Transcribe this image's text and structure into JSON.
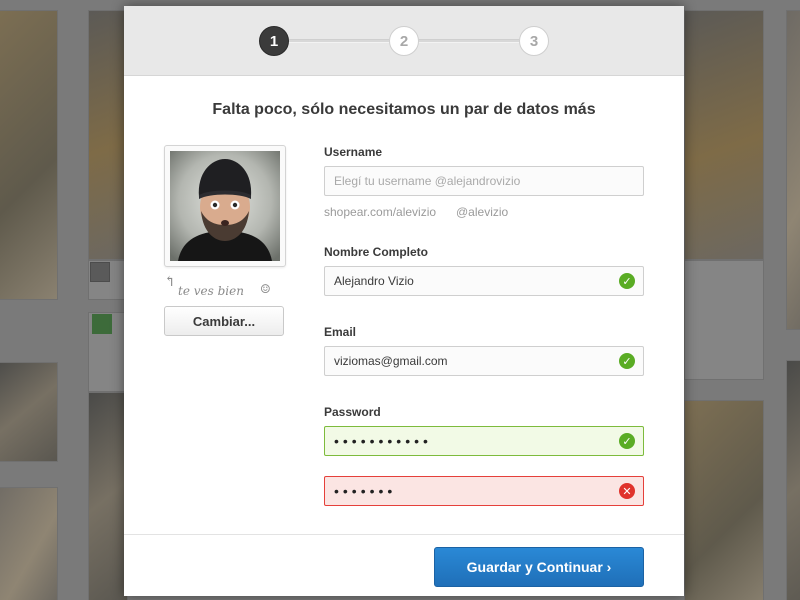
{
  "steps": [
    "1",
    "2",
    "3"
  ],
  "active_step": 1,
  "title": "Falta poco, sólo necesitamos un par de datos más",
  "profile": {
    "photo_icon": "user-photo",
    "caption": "te ves bien",
    "caption_icon": "curved-arrow-icon",
    "smile_icon": "smile-icon",
    "change_label": "Cambiar..."
  },
  "form": {
    "username": {
      "label": "Username",
      "placeholder": "Elegí tu username @alejandrovizio",
      "url_hint": "shopear.com/alevizio",
      "handle_hint": "@alevizio"
    },
    "fullname": {
      "label": "Nombre Completo",
      "value": "Alejandro Vizio",
      "status": "valid"
    },
    "email": {
      "label": "Email",
      "value": "viziomas@gmail.com",
      "status": "valid"
    },
    "password": {
      "label": "Password",
      "value_masked": "•••••••••••",
      "status": "valid"
    },
    "password_confirm": {
      "value_masked": "•••••••",
      "status": "invalid"
    }
  },
  "icons": {
    "valid": "✓",
    "invalid": "✕"
  },
  "colors": {
    "valid": "#5aac24",
    "invalid": "#e0332c",
    "primary": "#2a89d6"
  },
  "footer": {
    "save_label": "Guardar y Continuar ›"
  }
}
